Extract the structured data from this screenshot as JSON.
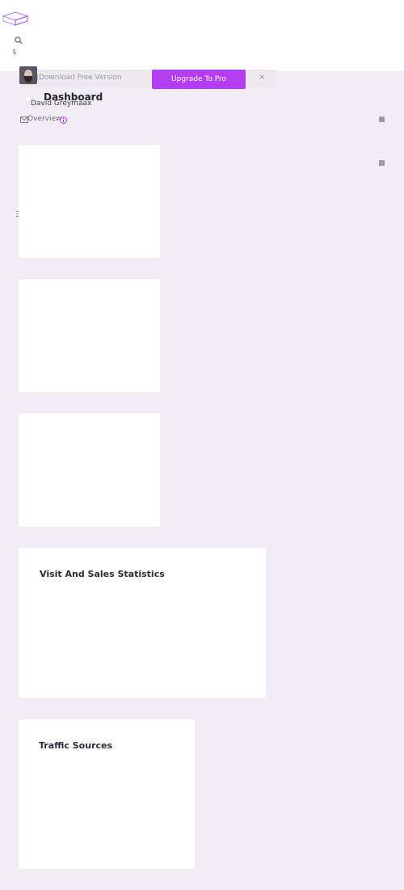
{
  "header": {
    "logo_icon": "cube-logo-icon",
    "search_icon": "search-icon",
    "currency_symbol": "$"
  },
  "promo": {
    "download_label": "Download Free Version",
    "upgrade_label": "Upgrade To Pro",
    "close_label": "×",
    "accent": "#b33ef0"
  },
  "user": {
    "name": "David Greymaax"
  },
  "page": {
    "title": "Dashboard",
    "overview_label": "Overview"
  },
  "sidebar_icons": [
    "mail-icon",
    "bell-icon",
    "list-icon"
  ],
  "cards": {
    "visit_sales": {
      "title": "Visit And Sales Statistics"
    },
    "traffic": {
      "title": "Traffic Sources"
    }
  }
}
